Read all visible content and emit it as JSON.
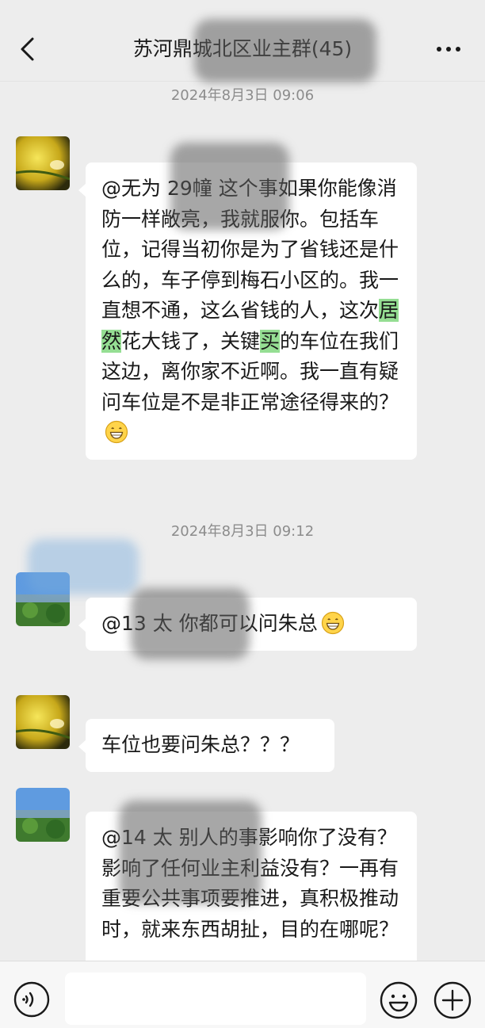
{
  "header": {
    "title": "苏河鼎城北区业主群(45)"
  },
  "messages": [
    {
      "time": "2024年8月3日 09:06",
      "parts": [
        {
          "text": "@无为 29幢 "
        },
        {
          "text": "这个事如果你能像消防一样敞亮，我就服你。包括车位，记得当初你是为了省钱还是什么的，车子停到梅石小区的。我一直想不通，这么省钱的人，这次"
        },
        {
          "text": "居然",
          "hl": true
        },
        {
          "text": "花大钱了，关键"
        },
        {
          "text": "买",
          "hl": true
        },
        {
          "text": "的车位在我们这边，离你家不近啊。我一直有疑问车位是不是非正常途径得来的？"
        }
      ],
      "emoji": "grin-emoji"
    },
    {
      "time": "2024年8月3日 09:12",
      "parts": [
        {
          "text": "@13 太  你都可以问朱总"
        }
      ],
      "emoji": "grin-emoji"
    },
    {
      "parts": [
        {
          "text": "车位也要问朱总？？？"
        }
      ]
    },
    {
      "parts": [
        {
          "text": "@14 太  别人的事影响你了没有？影响了任何业主利益没有？一再有重要公共事项要推进，真积极推动时，就来东西胡扯，目的在哪呢？"
        }
      ]
    }
  ],
  "input": {
    "placeholder": ""
  },
  "colors": {
    "background": "#ededed",
    "bubble": "#ffffff",
    "highlight": "#95de93",
    "time_text": "#8c8c8c"
  }
}
